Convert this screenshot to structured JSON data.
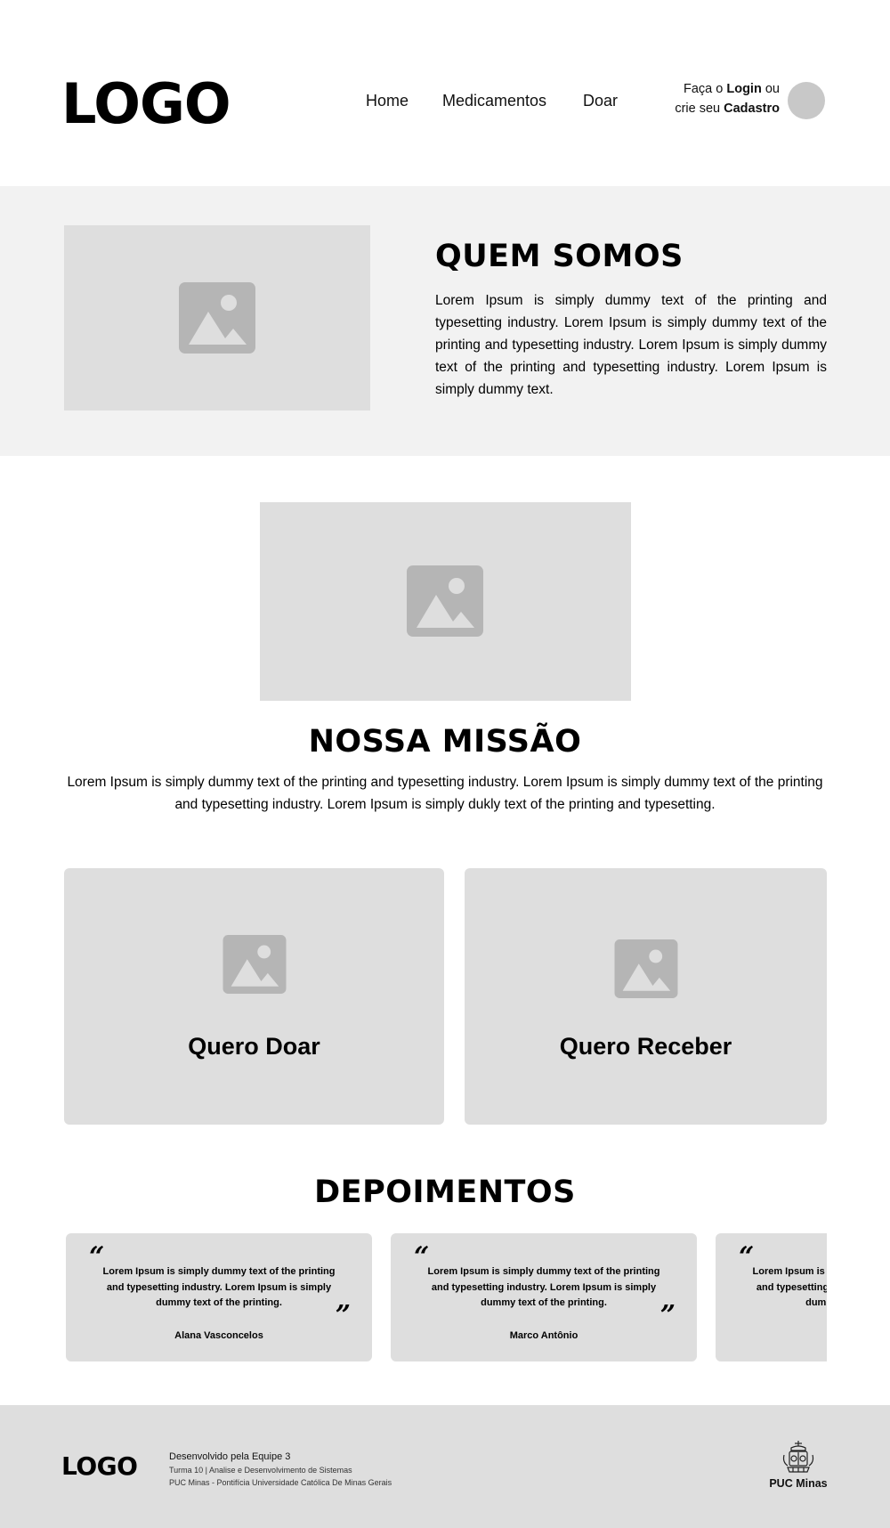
{
  "header": {
    "logo": "LOGO",
    "nav": [
      "Home",
      "Medicamentos",
      "Doar"
    ],
    "auth": {
      "prefix1": "Faça o ",
      "login": "Login",
      "suffix1": " ou",
      "prefix2": "crie seu ",
      "cadastro": "Cadastro"
    }
  },
  "about": {
    "title": "QUEM SOMOS",
    "text": "Lorem Ipsum is simply dummy text of the printing and typesetting industry. Lorem Ipsum is simply dummy text of the printing and typesetting industry. Lorem Ipsum is simply dummy text of the printing and typesetting industry. Lorem Ipsum is simply dummy text."
  },
  "mission": {
    "title": "NOSSA MISSÃO",
    "text": "Lorem Ipsum is simply dummy text of the printing and typesetting industry. Lorem Ipsum is simply dummy text of the printing and typesetting industry. Lorem Ipsum is simply dukly text of the printing and typesetting."
  },
  "cards": {
    "doar": "Quero Doar",
    "receber": "Quero Receber"
  },
  "testimonials": {
    "title": "DEPOIMENTOS",
    "open_quote": "“",
    "close_quote": "”",
    "items": [
      {
        "text": "Lorem Ipsum is simply dummy text of the printing and typesetting industry. Lorem Ipsum is simply dummy text of the printing.",
        "name": "Alana Vasconcelos"
      },
      {
        "text": "Lorem Ipsum is simply dummy text of the printing and typesetting industry. Lorem Ipsum is simply dummy text of the printing.",
        "name": "Marco Antônio"
      },
      {
        "text": "Lorem Ipsum is simply dummy text of the printing and typesetting industry. Lorem Ipsum is simply dummy text of the printing.",
        "name": ""
      }
    ]
  },
  "footer": {
    "logo": "LOGO",
    "line1": "Desenvolvido pela Equipe 3",
    "line2": "Turma 10 | Analise e Desenvolvimento de Sistemas",
    "line3": "PUC Minas - Pontifícia Universidade Católica De Minas Gerais",
    "institution": "PUC Minas"
  },
  "icons": {
    "image_placeholder": "image-placeholder-icon",
    "avatar": "user-avatar",
    "crest": "puc-crest-icon"
  },
  "colors": {
    "section_bg": "#f2f2f2",
    "placeholder_bg": "#dedede",
    "icon": "#b5b5b5",
    "avatar": "#c8c8c8"
  }
}
